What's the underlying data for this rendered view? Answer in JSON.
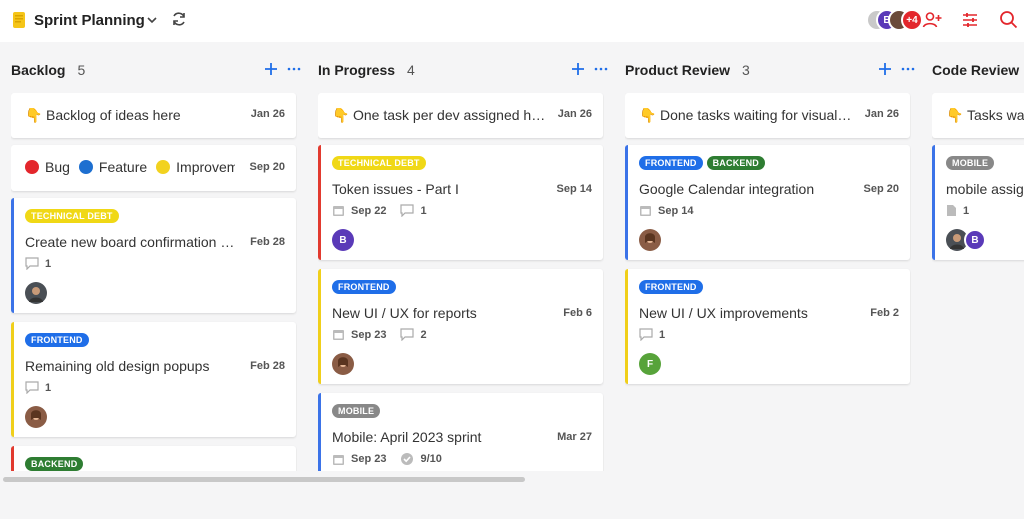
{
  "header": {
    "title": "Sprint Planning",
    "avatars": [
      "",
      "B",
      "",
      "+4"
    ]
  },
  "columns": [
    {
      "name": "Backlog",
      "count": "5",
      "cards": [
        {
          "kind": "note",
          "emoji": "👇",
          "text": "Backlog of ideas here",
          "date": "Jan 26"
        },
        {
          "kind": "legend",
          "items": [
            {
              "label": "Bug",
              "color": "#e3262c"
            },
            {
              "label": "Feature",
              "color": "#1d6fd0"
            },
            {
              "label": "Improvement",
              "color": "#f2d21f"
            }
          ],
          "date": "Sep 20"
        },
        {
          "kind": "task",
          "border": "blue",
          "tags": [
            {
              "label": "TECHNICAL DEBT",
              "color": "yellow"
            }
          ],
          "title": "Create new board confirmation popup",
          "date": "Feb 28",
          "comments": "1",
          "avatar": "photo-man"
        },
        {
          "kind": "task",
          "border": "yellow",
          "tags": [
            {
              "label": "FRONTEND",
              "color": "blue"
            }
          ],
          "title": "Remaining old design popups",
          "date": "Feb 28",
          "comments": "1",
          "avatar": "photo-woman"
        },
        {
          "kind": "task",
          "border": "red",
          "tags": [
            {
              "label": "BACKEND",
              "color": "green"
            }
          ],
          "title": "",
          "date": "",
          "comments": "",
          "avatar": ""
        }
      ]
    },
    {
      "name": "In Progress",
      "count": "4",
      "cards": [
        {
          "kind": "note",
          "emoji": "👇",
          "text": "One task per dev assigned here",
          "date": "Jan 26"
        },
        {
          "kind": "task",
          "border": "red",
          "tags": [
            {
              "label": "TECHNICAL DEBT",
              "color": "yellow"
            }
          ],
          "title": "Token issues - Part I",
          "date": "Sep 14",
          "due": "Sep 22",
          "comments": "1",
          "avatar": "B"
        },
        {
          "kind": "task",
          "border": "yellow",
          "tags": [
            {
              "label": "FRONTEND",
              "color": "blue"
            }
          ],
          "title": "New UI / UX for reports",
          "date": "Feb 6",
          "due": "Sep 23",
          "comments": "2",
          "avatar": "photo-woman"
        },
        {
          "kind": "task",
          "border": "blue",
          "tags": [
            {
              "label": "MOBILE",
              "color": "gray"
            }
          ],
          "title": "Mobile: April 2023 sprint",
          "date": "Mar 27",
          "due": "Sep 23",
          "checklist": "9/10"
        }
      ]
    },
    {
      "name": "Product Review",
      "count": "3",
      "cards": [
        {
          "kind": "note",
          "emoji": "👇",
          "text": "Done tasks waiting for visual review",
          "date": "Jan 26"
        },
        {
          "kind": "task",
          "border": "blue",
          "tags": [
            {
              "label": "FRONTEND",
              "color": "blue"
            },
            {
              "label": "BACKEND",
              "color": "green"
            }
          ],
          "title": "Google Calendar integration",
          "date": "Sep 20",
          "due": "Sep 14",
          "avatar": "photo-woman"
        },
        {
          "kind": "task",
          "border": "yellow",
          "tags": [
            {
              "label": "FRONTEND",
              "color": "blue"
            }
          ],
          "title": "New UI / UX improvements",
          "date": "Feb 2",
          "comments": "1",
          "avatar": "F"
        }
      ]
    },
    {
      "name": "Code Review",
      "count": "",
      "cards": [
        {
          "kind": "note",
          "emoji": "👇",
          "text": "Tasks waiting for code review",
          "date": ""
        },
        {
          "kind": "task",
          "border": "blue",
          "tags": [
            {
              "label": "MOBILE",
              "color": "gray"
            }
          ],
          "title": "mobile assignments",
          "date": "",
          "attachments": "1",
          "avatar": "photo-man",
          "avatar2": "B"
        }
      ]
    }
  ],
  "colors": {
    "accent": "#1f6ee8",
    "alert": "#e3262c"
  }
}
